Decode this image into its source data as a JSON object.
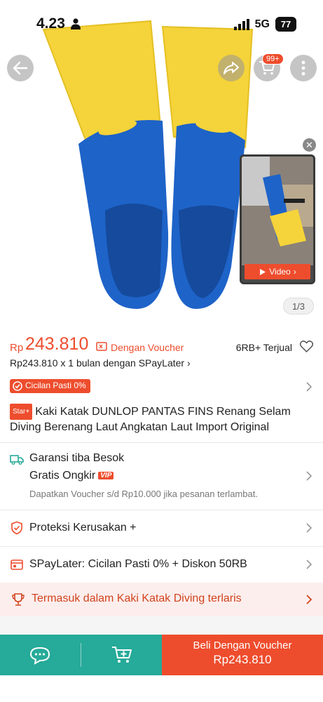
{
  "status_bar": {
    "time": "4.23",
    "network": "5G",
    "battery": "77"
  },
  "top_nav": {
    "cart_badge": "99+"
  },
  "media": {
    "video_label": "Video",
    "image_counter": "1/3"
  },
  "price": {
    "currency": "Rp",
    "value": "243.810",
    "voucher_label": "Dengan Voucher",
    "sold": "6RB+ Terjual",
    "spaylater_text": "Rp243.810 x 1 bulan dengan SPayLater"
  },
  "cicilan_badge": "Cicilan Pasti 0%",
  "product": {
    "star_badge": "Star+",
    "title": "Kaki Katak DUNLOP PANTAS FINS Renang Selam Diving Berenang Laut Angkatan Laut Import Original"
  },
  "shipping": {
    "guarantee": "Garansi tiba Besok",
    "free_shipping": "Gratis Ongkir",
    "vip_badge": "VIP",
    "note": "Dapatkan Voucher s/d Rp10.000 jika pesanan terlambat."
  },
  "protection": {
    "label": "Proteksi Kerusakan +"
  },
  "spaylater_row": {
    "label": "SPayLater: Cicilan Pasti 0% + Diskon 50RB"
  },
  "bestseller": {
    "label": "Termasuk dalam Kaki Katak Diving terlaris"
  },
  "bottom_bar": {
    "buy_label": "Beli Dengan Voucher",
    "buy_price": "Rp243.810"
  },
  "colors": {
    "accent": "#ee4d2d",
    "teal": "#26aa99",
    "fin_yellow": "#f5d33a",
    "fin_blue": "#1e63c8"
  },
  "icons": [
    "person-icon",
    "signal-icon",
    "back-arrow-icon",
    "share-icon",
    "cart-icon",
    "more-icon",
    "close-icon",
    "play-icon",
    "voucher-icon",
    "heart-icon",
    "check-icon",
    "truck-icon",
    "shield-icon",
    "spaylater-icon",
    "trophy-icon",
    "chevron-right-icon",
    "chat-icon",
    "add-to-cart-icon"
  ]
}
